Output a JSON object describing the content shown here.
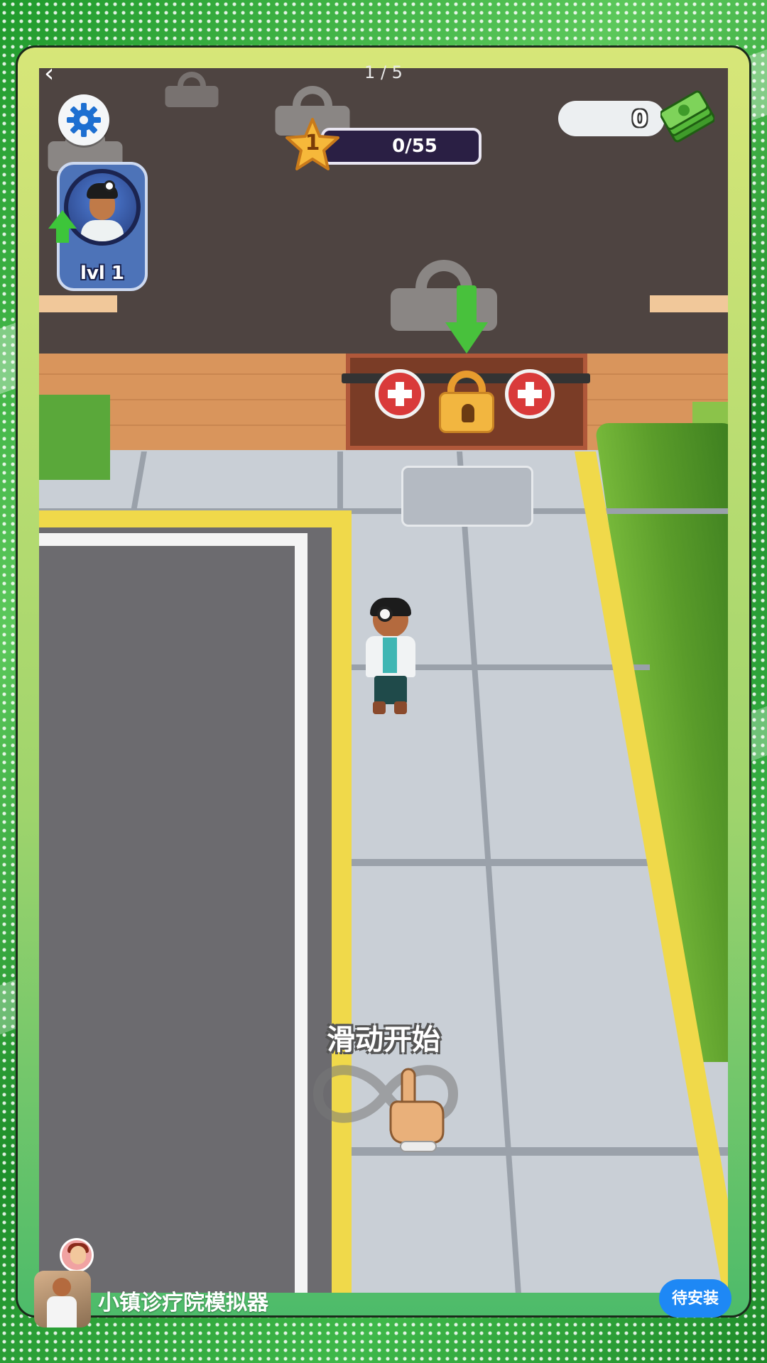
{
  "nav": {
    "back_icon": "chevron-left-icon",
    "back_glyph": "‹",
    "page_indicator": "1 / 5"
  },
  "hud": {
    "settings_icon": "gear-icon",
    "player_level_label": "lvl 1",
    "star_level": "1",
    "xp_progress": "0/55",
    "cash_amount": "0"
  },
  "game": {
    "hint_text": "滑动开始"
  },
  "ad_bar": {
    "app_name": "小镇诊疗院模拟器",
    "install_label": "待安装"
  },
  "colors": {
    "install_button": "#1e88f5",
    "xp_bar": "#2a1f44",
    "level_card": "#4d73b8",
    "arrow_green": "#48c13c"
  }
}
